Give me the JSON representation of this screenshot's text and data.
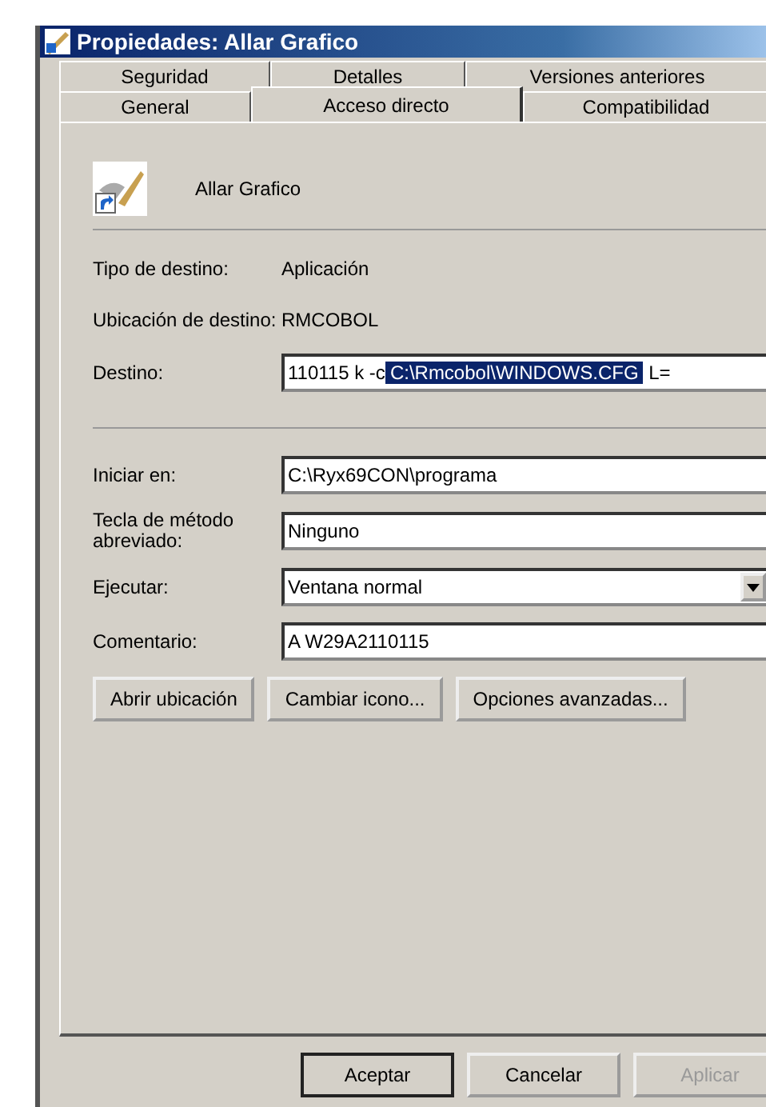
{
  "window": {
    "title": "Propiedades: Allar Grafico"
  },
  "tabs": {
    "rows": [
      {
        "items": [
          {
            "label": "Seguridad",
            "selected": false
          },
          {
            "label": "Detalles",
            "selected": false
          },
          {
            "label": "Versiones anteriores",
            "selected": false
          }
        ]
      },
      {
        "items": [
          {
            "label": "General",
            "selected": false
          },
          {
            "label": "Acceso directo",
            "selected": true
          },
          {
            "label": "Compatibilidad",
            "selected": false
          }
        ]
      }
    ]
  },
  "shortcut": {
    "name": "Allar Grafico"
  },
  "sections": [
    {
      "rows": [
        {
          "kind": "text",
          "label": "Tipo de destino:",
          "value": "Aplicación"
        },
        {
          "kind": "text",
          "label": "Ubicación de destino:",
          "value": "RMCOBOL"
        },
        {
          "kind": "field",
          "label": "Destino:",
          "value": "110115  k -c",
          "selection": "C:\\Rmcobol\\WINDOWS.CFG",
          "value_after": "L="
        }
      ]
    },
    {
      "rows": [
        {
          "kind": "field",
          "label": "Iniciar en:",
          "value": "C:\\Ryx69CON\\programa"
        },
        {
          "kind": "field",
          "label": "Tecla de método abreviado:",
          "value": "Ninguno"
        },
        {
          "kind": "dropdown",
          "label": "Ejecutar:",
          "value": "Ventana normal"
        },
        {
          "kind": "field",
          "label": "Comentario:",
          "value": "A W29A2110115"
        }
      ]
    }
  ],
  "action_buttons": [
    "Abrir ubicación",
    "Cambiar icono...",
    "Opciones avanzadas..."
  ],
  "dialog_buttons": [
    {
      "label": "Aceptar",
      "default": true,
      "disabled": false
    },
    {
      "label": "Cancelar",
      "default": false,
      "disabled": false
    },
    {
      "label": "Aplicar",
      "default": false,
      "disabled": true
    }
  ]
}
